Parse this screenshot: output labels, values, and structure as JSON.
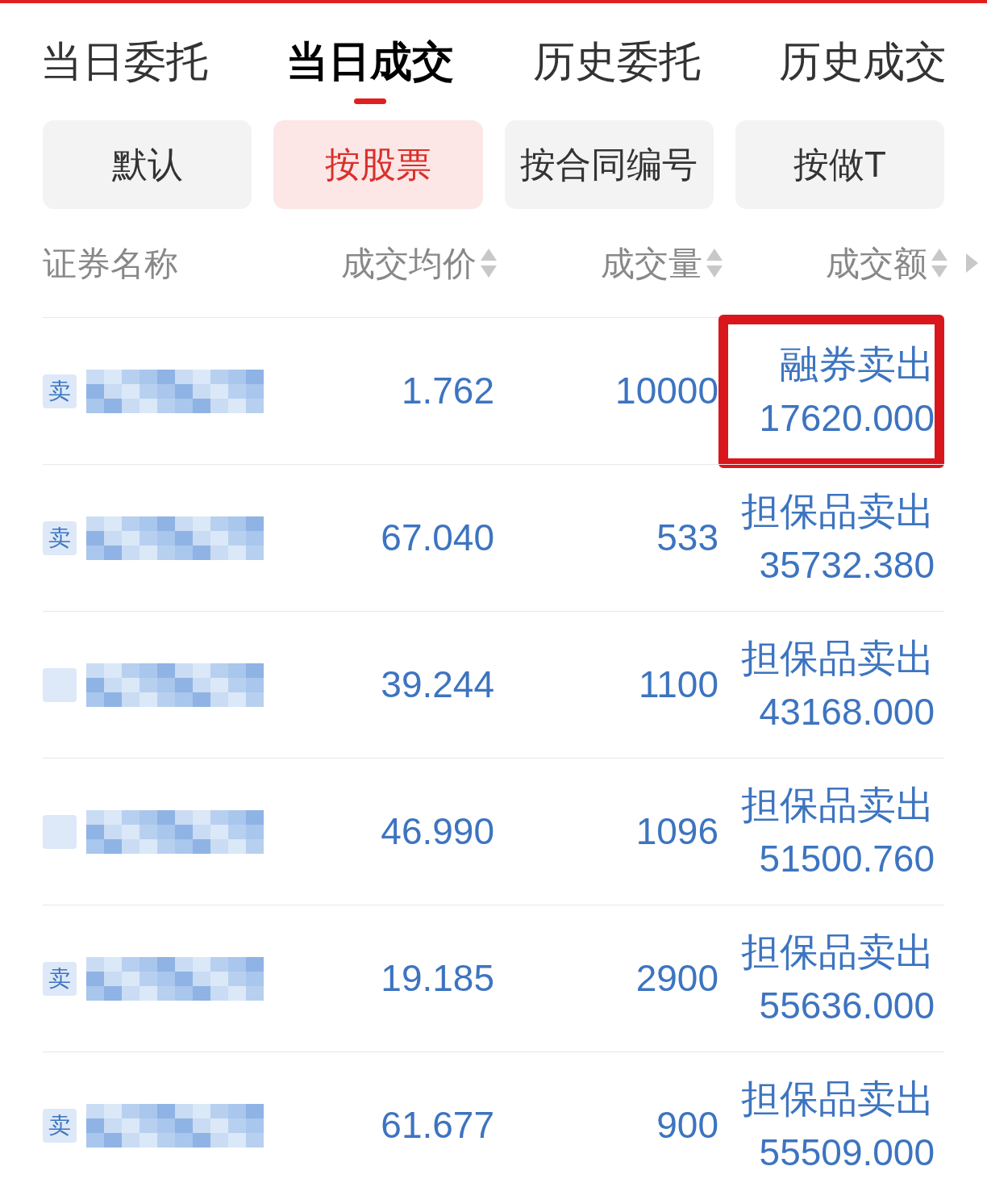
{
  "tabs": [
    {
      "label": "当日委托",
      "selected": false
    },
    {
      "label": "当日成交",
      "selected": true
    },
    {
      "label": "历史委托",
      "selected": false
    },
    {
      "label": "历史成交",
      "selected": false
    }
  ],
  "filters": [
    {
      "label": "默认",
      "selected": false
    },
    {
      "label": "按股票",
      "selected": true
    },
    {
      "label": "按合同编号",
      "selected": false
    },
    {
      "label": "按做T",
      "selected": false
    }
  ],
  "columns": [
    {
      "label": "证券名称",
      "sortable": false
    },
    {
      "label": "成交均价",
      "sortable": true
    },
    {
      "label": "成交量",
      "sortable": true
    },
    {
      "label": "成交额",
      "sortable": true
    }
  ],
  "rows": [
    {
      "side": "卖",
      "price": "1.762",
      "volume": "10000",
      "type": "融券卖出",
      "amount": "17620.000",
      "highlighted": true
    },
    {
      "side": "卖",
      "price": "67.040",
      "volume": "533",
      "type": "担保品卖出",
      "amount": "35732.380",
      "highlighted": false
    },
    {
      "price": "39.244",
      "volume": "1100",
      "type": "担保品卖出",
      "amount": "43168.000",
      "highlighted": false
    },
    {
      "price": "46.990",
      "volume": "1096",
      "type": "担保品卖出",
      "amount": "51500.760",
      "highlighted": false
    },
    {
      "side": "卖",
      "price": "19.185",
      "volume": "2900",
      "type": "担保品卖出",
      "amount": "55636.000",
      "highlighted": false
    },
    {
      "side": "卖",
      "price": "61.677",
      "volume": "900",
      "type": "担保品卖出",
      "amount": "55509.000",
      "highlighted": false
    }
  ]
}
